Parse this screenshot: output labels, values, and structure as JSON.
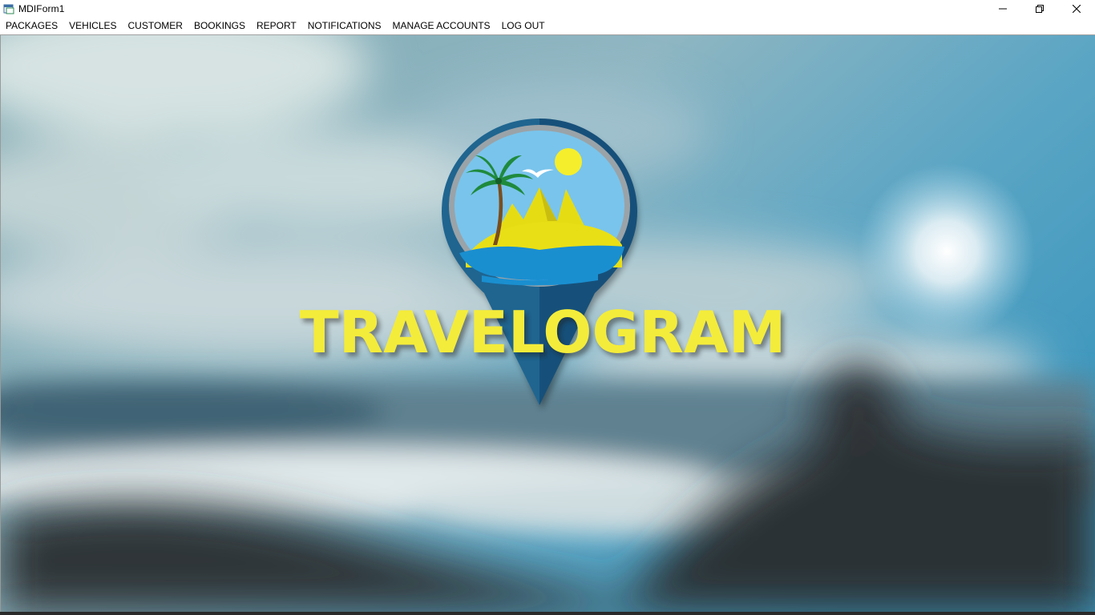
{
  "window": {
    "title": "MDIForm1",
    "icon": "form-app-icon",
    "controls": {
      "minimize": "—",
      "restore": "❐",
      "close": "✕"
    }
  },
  "menu": {
    "items": [
      {
        "label": "PACKAGES"
      },
      {
        "label": "VEHICLES"
      },
      {
        "label": "CUSTOMER"
      },
      {
        "label": "BOOKINGS"
      },
      {
        "label": "REPORT"
      },
      {
        "label": "NOTIFICATIONS"
      },
      {
        "label": "MANAGE ACCOUNTS"
      },
      {
        "label": "LOG OUT"
      }
    ]
  },
  "background": {
    "description_colors": {
      "sky_top": "#6fa7b8",
      "sky_right": "#4e9fbd",
      "sea": "#5a7e8a",
      "rocks": "#2f3336"
    }
  },
  "logo": {
    "brand_text": "TRAVELOGRAM",
    "brand_color": "#f4ec3a",
    "pin_color": "#1c5f86",
    "ring_color": "#9aa3a8",
    "sky_color": "#79c4ec",
    "sun_color": "#f5ee2c",
    "sand_color": "#e6dc14",
    "water_color": "#1a8fd0"
  }
}
